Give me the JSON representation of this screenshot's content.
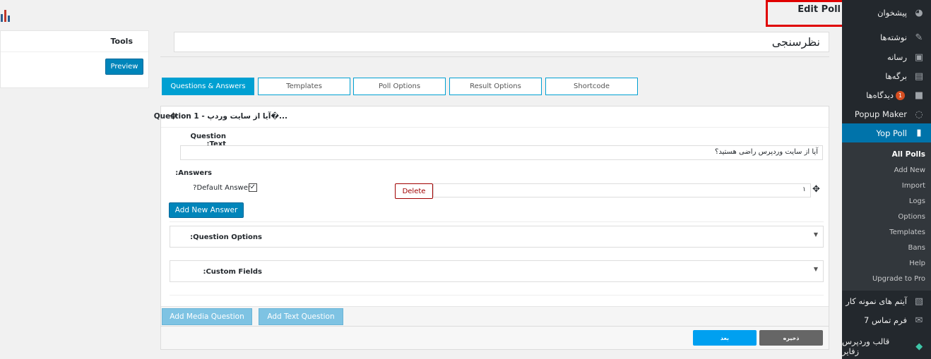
{
  "page_title": "Edit Poll",
  "poll_title": "نظرسنجی",
  "tools": {
    "title": "Tools",
    "preview_label": "Preview"
  },
  "tabs": [
    {
      "label": "Questions & Answers",
      "active": true
    },
    {
      "label": "Templates",
      "active": false
    },
    {
      "label": "Poll Options",
      "active": false
    },
    {
      "label": "Result Options",
      "active": false
    },
    {
      "label": "Shortcode",
      "active": false
    }
  ],
  "question": {
    "header": "Question 1 - آیا از سایت وردپ�...",
    "text_label": "Question Text:",
    "text_value": "آیا از سایت وردپرس راضی هستید؟",
    "answers_label": "Answers:",
    "default_answer_label": "Default Answer?",
    "default_answer_checked": true,
    "answer_value": "۱",
    "delete_label": "Delete",
    "add_answer_label": "Add New Answer",
    "question_options_label": "Question Options:",
    "custom_fields_label": "Custom Fields:"
  },
  "bottom_buttons": {
    "media": "Add Media Question",
    "text": "Add Text Question"
  },
  "footer_buttons": {
    "save": "ذخیره",
    "next": "بعد"
  },
  "admin_menu": {
    "items": [
      {
        "label": "پیشخوان",
        "icon": "dashboard-icon",
        "glyph": "◕"
      },
      {
        "label": "نوشته‌ها",
        "icon": "pin-icon",
        "glyph": "✎"
      },
      {
        "label": "رسانه",
        "icon": "media-icon",
        "glyph": "▣"
      },
      {
        "label": "برگه‌ها",
        "icon": "pages-icon",
        "glyph": "▤"
      },
      {
        "label": "دیدگاه‌ها",
        "icon": "comments-icon",
        "glyph": "■",
        "badge": "1"
      },
      {
        "label": "Popup Maker",
        "icon": "popup-maker-icon",
        "glyph": "◌"
      },
      {
        "label": "Yop Poll",
        "icon": "poll-chart-icon",
        "glyph": "▮",
        "active": true
      },
      {
        "label": "آیتم های نمونه کار",
        "icon": "portfolio-icon",
        "glyph": "▧"
      },
      {
        "label": "فرم تماس 7",
        "icon": "mail-icon",
        "glyph": "✉"
      },
      {
        "label": "قالب وردپرس زفایر",
        "icon": "diamond-icon",
        "glyph": "◆"
      }
    ],
    "submenu": [
      "All Polls",
      "Add New",
      "Import",
      "Logs",
      "Options",
      "Templates",
      "Bans",
      "Help",
      "Upgrade to Pro"
    ],
    "submenu_current": "All Polls"
  },
  "colors": {
    "accent": "#0073aa",
    "tab_active": "#00a0d2",
    "sidebar": "#23282d",
    "highlight_box": "#e00000",
    "delete": "#a00000"
  }
}
